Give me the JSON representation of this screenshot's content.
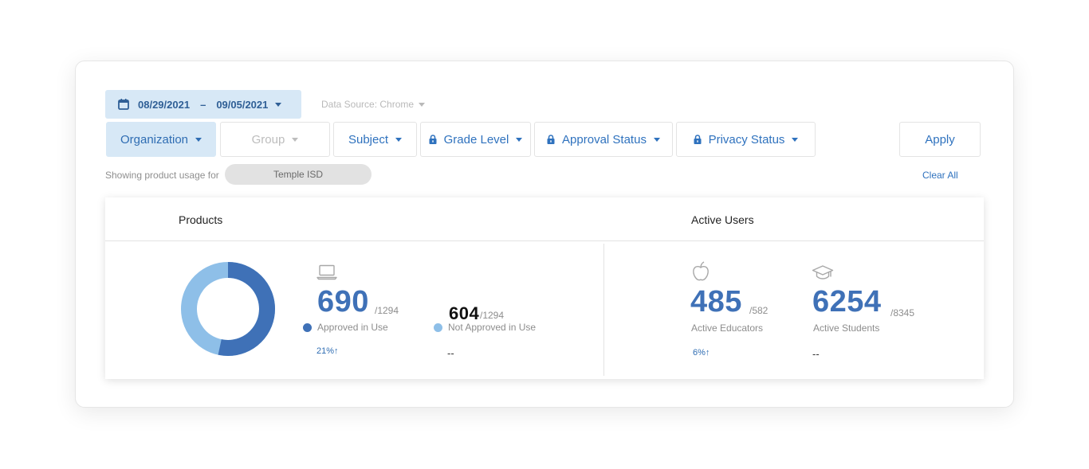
{
  "colors": {
    "accent": "#3f71b7",
    "accent_light": "#8ebfe8",
    "selected_bg": "#d7e8f6"
  },
  "date_range": {
    "start": "08/29/2021",
    "separator": "–",
    "end": "09/05/2021",
    "icon": "calendar-icon"
  },
  "data_source": {
    "label": "Data Source: Chrome"
  },
  "filters": {
    "organization": {
      "label": "Organization",
      "state": "selected"
    },
    "group": {
      "label": "Group",
      "state": "disabled"
    },
    "subject": {
      "label": "Subject"
    },
    "grade_level": {
      "label": "Grade Level",
      "icon": "lock-icon"
    },
    "approval_status": {
      "label": "Approval Status",
      "icon": "lock-icon"
    },
    "privacy_status": {
      "label": "Privacy Status",
      "icon": "lock-icon"
    }
  },
  "apply_label": "Apply",
  "clear_all_label": "Clear All",
  "showing": {
    "prefix": "Showing product usage for",
    "organization": "Temple ISD"
  },
  "products": {
    "title": "Products",
    "donut": {
      "approved_fraction": 0.533,
      "approved_color": "#3f71b7",
      "other_color": "#8ebfe8"
    },
    "approved": {
      "value": "690",
      "denom": "/1294",
      "label": "Approved in Use",
      "trend": "21%↑",
      "icon": "laptop-icon"
    },
    "not_approved": {
      "value": "604",
      "denom": "/1294",
      "label": "Not Approved in Use",
      "trend": "--"
    }
  },
  "active_users": {
    "title": "Active Users",
    "educators": {
      "value": "485",
      "denom": "/582",
      "label": "Active Educators",
      "trend": "6%↑",
      "icon": "apple-icon"
    },
    "students": {
      "value": "6254",
      "denom": "/8345",
      "label": "Active Students",
      "trend": "--",
      "icon": "graduation-cap-icon"
    }
  }
}
